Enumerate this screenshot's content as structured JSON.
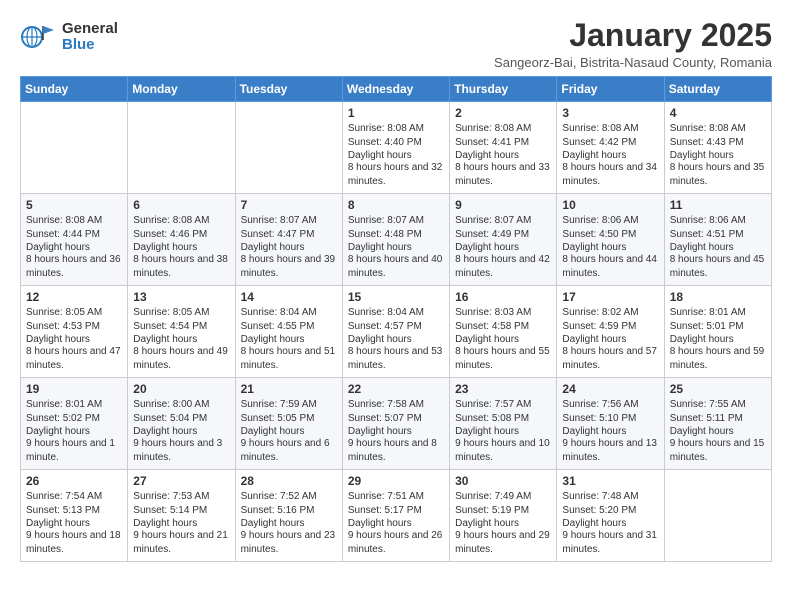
{
  "logo": {
    "general": "General",
    "blue": "Blue"
  },
  "title": "January 2025",
  "subtitle": "Sangeorz-Bai, Bistrita-Nasaud County, Romania",
  "days_of_week": [
    "Sunday",
    "Monday",
    "Tuesday",
    "Wednesday",
    "Thursday",
    "Friday",
    "Saturday"
  ],
  "weeks": [
    [
      {
        "day": "",
        "content": ""
      },
      {
        "day": "",
        "content": ""
      },
      {
        "day": "",
        "content": ""
      },
      {
        "day": "1",
        "content": "Sunrise: 8:08 AM\nSunset: 4:40 PM\nDaylight: 8 hours and 32 minutes."
      },
      {
        "day": "2",
        "content": "Sunrise: 8:08 AM\nSunset: 4:41 PM\nDaylight: 8 hours and 33 minutes."
      },
      {
        "day": "3",
        "content": "Sunrise: 8:08 AM\nSunset: 4:42 PM\nDaylight: 8 hours and 34 minutes."
      },
      {
        "day": "4",
        "content": "Sunrise: 8:08 AM\nSunset: 4:43 PM\nDaylight: 8 hours and 35 minutes."
      }
    ],
    [
      {
        "day": "5",
        "content": "Sunrise: 8:08 AM\nSunset: 4:44 PM\nDaylight: 8 hours and 36 minutes."
      },
      {
        "day": "6",
        "content": "Sunrise: 8:08 AM\nSunset: 4:46 PM\nDaylight: 8 hours and 38 minutes."
      },
      {
        "day": "7",
        "content": "Sunrise: 8:07 AM\nSunset: 4:47 PM\nDaylight: 8 hours and 39 minutes."
      },
      {
        "day": "8",
        "content": "Sunrise: 8:07 AM\nSunset: 4:48 PM\nDaylight: 8 hours and 40 minutes."
      },
      {
        "day": "9",
        "content": "Sunrise: 8:07 AM\nSunset: 4:49 PM\nDaylight: 8 hours and 42 minutes."
      },
      {
        "day": "10",
        "content": "Sunrise: 8:06 AM\nSunset: 4:50 PM\nDaylight: 8 hours and 44 minutes."
      },
      {
        "day": "11",
        "content": "Sunrise: 8:06 AM\nSunset: 4:51 PM\nDaylight: 8 hours and 45 minutes."
      }
    ],
    [
      {
        "day": "12",
        "content": "Sunrise: 8:05 AM\nSunset: 4:53 PM\nDaylight: 8 hours and 47 minutes."
      },
      {
        "day": "13",
        "content": "Sunrise: 8:05 AM\nSunset: 4:54 PM\nDaylight: 8 hours and 49 minutes."
      },
      {
        "day": "14",
        "content": "Sunrise: 8:04 AM\nSunset: 4:55 PM\nDaylight: 8 hours and 51 minutes."
      },
      {
        "day": "15",
        "content": "Sunrise: 8:04 AM\nSunset: 4:57 PM\nDaylight: 8 hours and 53 minutes."
      },
      {
        "day": "16",
        "content": "Sunrise: 8:03 AM\nSunset: 4:58 PM\nDaylight: 8 hours and 55 minutes."
      },
      {
        "day": "17",
        "content": "Sunrise: 8:02 AM\nSunset: 4:59 PM\nDaylight: 8 hours and 57 minutes."
      },
      {
        "day": "18",
        "content": "Sunrise: 8:01 AM\nSunset: 5:01 PM\nDaylight: 8 hours and 59 minutes."
      }
    ],
    [
      {
        "day": "19",
        "content": "Sunrise: 8:01 AM\nSunset: 5:02 PM\nDaylight: 9 hours and 1 minute."
      },
      {
        "day": "20",
        "content": "Sunrise: 8:00 AM\nSunset: 5:04 PM\nDaylight: 9 hours and 3 minutes."
      },
      {
        "day": "21",
        "content": "Sunrise: 7:59 AM\nSunset: 5:05 PM\nDaylight: 9 hours and 6 minutes."
      },
      {
        "day": "22",
        "content": "Sunrise: 7:58 AM\nSunset: 5:07 PM\nDaylight: 9 hours and 8 minutes."
      },
      {
        "day": "23",
        "content": "Sunrise: 7:57 AM\nSunset: 5:08 PM\nDaylight: 9 hours and 10 minutes."
      },
      {
        "day": "24",
        "content": "Sunrise: 7:56 AM\nSunset: 5:10 PM\nDaylight: 9 hours and 13 minutes."
      },
      {
        "day": "25",
        "content": "Sunrise: 7:55 AM\nSunset: 5:11 PM\nDaylight: 9 hours and 15 minutes."
      }
    ],
    [
      {
        "day": "26",
        "content": "Sunrise: 7:54 AM\nSunset: 5:13 PM\nDaylight: 9 hours and 18 minutes."
      },
      {
        "day": "27",
        "content": "Sunrise: 7:53 AM\nSunset: 5:14 PM\nDaylight: 9 hours and 21 minutes."
      },
      {
        "day": "28",
        "content": "Sunrise: 7:52 AM\nSunset: 5:16 PM\nDaylight: 9 hours and 23 minutes."
      },
      {
        "day": "29",
        "content": "Sunrise: 7:51 AM\nSunset: 5:17 PM\nDaylight: 9 hours and 26 minutes."
      },
      {
        "day": "30",
        "content": "Sunrise: 7:49 AM\nSunset: 5:19 PM\nDaylight: 9 hours and 29 minutes."
      },
      {
        "day": "31",
        "content": "Sunrise: 7:48 AM\nSunset: 5:20 PM\nDaylight: 9 hours and 31 minutes."
      },
      {
        "day": "",
        "content": ""
      }
    ]
  ]
}
